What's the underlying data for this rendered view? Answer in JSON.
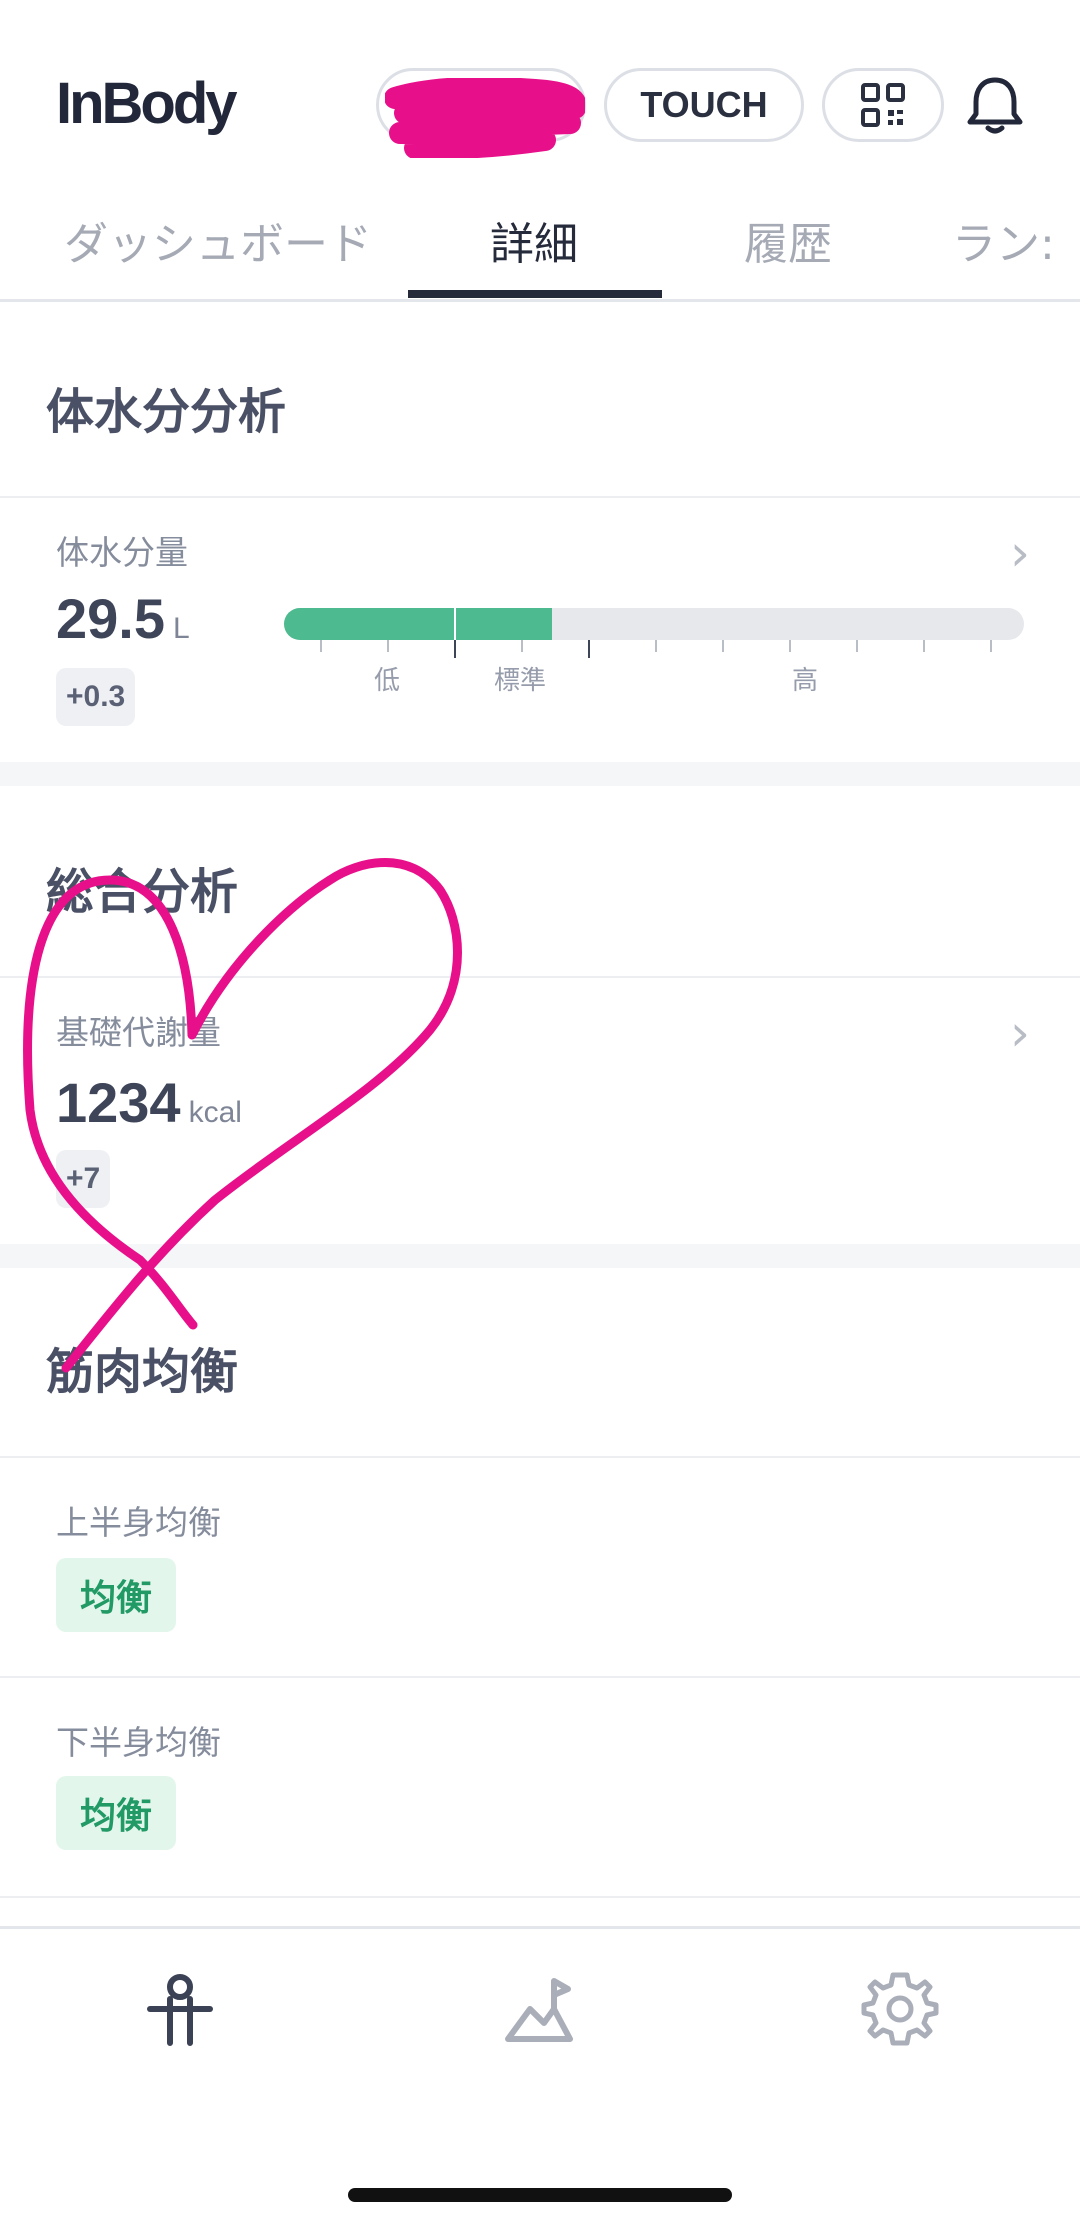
{
  "header": {
    "logo": "InBody",
    "touch_label": "TOUCH",
    "icons": {
      "qr": "qr-code-icon",
      "bell": "bell-icon"
    }
  },
  "tabs": [
    {
      "label": "ダッシュボード",
      "active": false
    },
    {
      "label": "詳細",
      "active": true
    },
    {
      "label": "履歴",
      "active": false
    },
    {
      "label": "ラン:",
      "active": false
    }
  ],
  "body_water": {
    "section_title": "体水分分析",
    "label": "体水分量",
    "value": "29.5",
    "unit": "L",
    "delta": "+0.3",
    "scale_labels": {
      "low": "低",
      "normal": "標準",
      "high": "高"
    }
  },
  "overall": {
    "section_title": "総合分析",
    "label": "基礎代謝量",
    "value": "1234",
    "unit": "kcal",
    "delta": "+7"
  },
  "muscle_balance": {
    "section_title": "筋肉均衡",
    "upper_label": "上半身均衡",
    "upper_status": "均衡",
    "lower_label": "下半身均衡",
    "lower_status": "均衡"
  },
  "bottom_nav": {
    "icons": [
      "body-icon",
      "chart-icon",
      "gear-icon"
    ]
  },
  "colors": {
    "accent_green": "#4dba90",
    "badge_green": "#229a66",
    "annotation_pink": "#e8108a"
  }
}
